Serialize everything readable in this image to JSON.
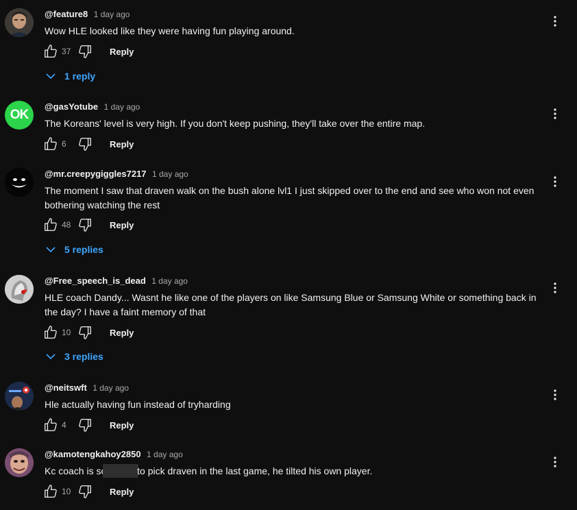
{
  "colors": {
    "background": "#0f0f0f",
    "link": "#3ea6ff",
    "muted": "#aaaaaa",
    "text": "#f1f1f1"
  },
  "icons": {
    "like": "thumb-up-icon",
    "dislike": "thumb-down-icon",
    "more": "more-vert-icon",
    "expand": "chevron-down-icon"
  },
  "reply_label": "Reply",
  "comments": [
    {
      "handle": "@feature8",
      "time": "1 day ago",
      "text": "Wow HLE looked like they were having fun playing around.",
      "likes": "37",
      "replies": "1 reply"
    },
    {
      "handle": "@gasYotube",
      "time": "1 day ago",
      "text": "The Koreans' level is very high. If you don't keep pushing, they'll take over the entire map.",
      "likes": "6",
      "avatar_text": "OK"
    },
    {
      "handle": "@mr.creepygiggles7217",
      "time": "1 day ago",
      "text": "The moment I saw that draven walk on the bush alone lvl1 I just skipped over to the end and see who won not even bothering watching the rest",
      "likes": "48",
      "replies": "5 replies"
    },
    {
      "handle": "@Free_speech_is_dead",
      "time": "1 day ago",
      "text": "HLE coach Dandy... Wasnt he like one of the players on like Samsung Blue or Samsung White or something back in the day? I have a faint memory of that",
      "likes": "10",
      "replies": "3 replies"
    },
    {
      "handle": "@neitswft",
      "time": "1 day ago",
      "text": "Hle actually having fun instead of tryharding",
      "likes": "4"
    },
    {
      "handle": "@kamotengkahoy2850",
      "time": "1 day ago",
      "text_before": "Kc coach is so",
      "text_after": " to pick draven in the last game, he tilted his own player.",
      "likes": "10"
    }
  ]
}
